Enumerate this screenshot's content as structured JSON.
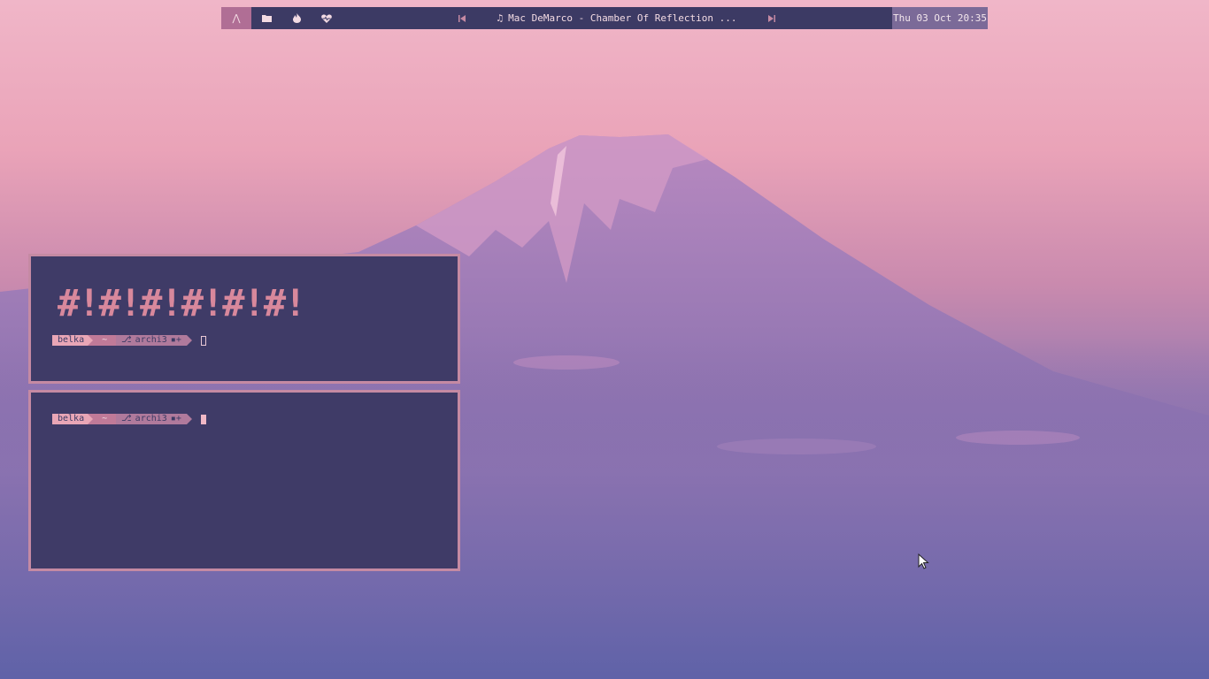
{
  "bar": {
    "workspaces": [
      {
        "icon": "arch-logo-icon",
        "glyph": "⋀",
        "active": true
      },
      {
        "icon": "folder-icon",
        "glyph": "▆",
        "active": false
      },
      {
        "icon": "flame-icon",
        "glyph": "🔥",
        "active": false
      },
      {
        "icon": "heartbeat-icon",
        "glyph": "♥",
        "active": false
      }
    ],
    "player": {
      "prev_glyph": "⏮",
      "note_glyph": "♫",
      "track": "Mac DeMarco - Chamber Of Reflection ...",
      "next_glyph": "⏭"
    },
    "clock": "Thu 03 Oct 20:35"
  },
  "terminals": [
    {
      "banner": "#!#!#!#!#!#!",
      "prompt": {
        "user": "belka",
        "dir": "~",
        "branch": "archi3",
        "git_status": "▪+"
      }
    },
    {
      "prompt": {
        "user": "belka",
        "dir": "~",
        "branch": "archi3",
        "git_status": "▪+"
      }
    }
  ],
  "colors": {
    "bar_bg": "#3c3a64",
    "accent": "#b06e95",
    "terminal_bg": "#3f3b67",
    "terminal_border": "#c58aa3",
    "pink": "#e9a6b6"
  }
}
